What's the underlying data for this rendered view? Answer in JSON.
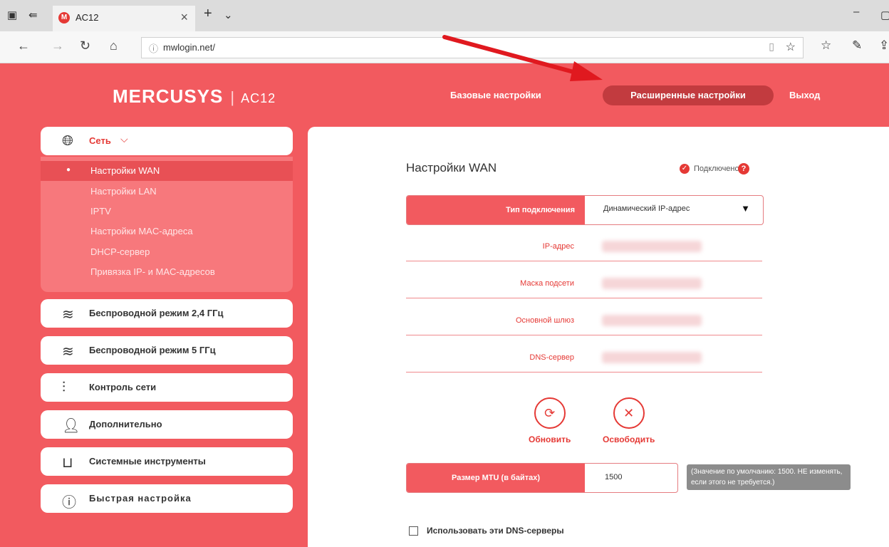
{
  "browser": {
    "tab_title": "AC12",
    "url": "mwlogin.net/"
  },
  "header": {
    "brand": "MERCUSYS",
    "model": "AC12",
    "nav": [
      "Базовые настройки",
      "Расширенные настройки",
      "Выход"
    ]
  },
  "sidebar": {
    "network": "Сеть",
    "sub_items": [
      "Настройки WAN",
      "Настройки LAN",
      "IPTV",
      "Настройки MAC-адреса",
      "DHCP-сервер",
      "Привязка IP- и MAC-адресов"
    ],
    "items": [
      "Беспроводной режим 2,4 ГГц",
      "Беспроводной режим 5 ГГц",
      "Контроль сети",
      "Дополнительно",
      "Системные инструменты",
      "Быстрая настройка"
    ]
  },
  "main": {
    "title": "Настройки WAN",
    "status": "Подключено",
    "connection_type_label": "Тип подключения",
    "connection_type_value": "Динамический IP-адрес",
    "fields": [
      "IP-адрес",
      "Маска подсети",
      "Основной шлюз",
      "DNS-сервер"
    ],
    "refresh_label": "Обновить",
    "release_label": "Освободить",
    "mtu_label": "Размер MTU (в байтах)",
    "mtu_value": "1500",
    "mtu_tip": "(Значение по умолчанию: 1500. НЕ изменять, если этого не требуется.)",
    "dns_checkbox": "Использовать эти DNS-серверы"
  },
  "colors": {
    "brand": "#f25a5f",
    "accent_dark": "#c23b3f"
  }
}
